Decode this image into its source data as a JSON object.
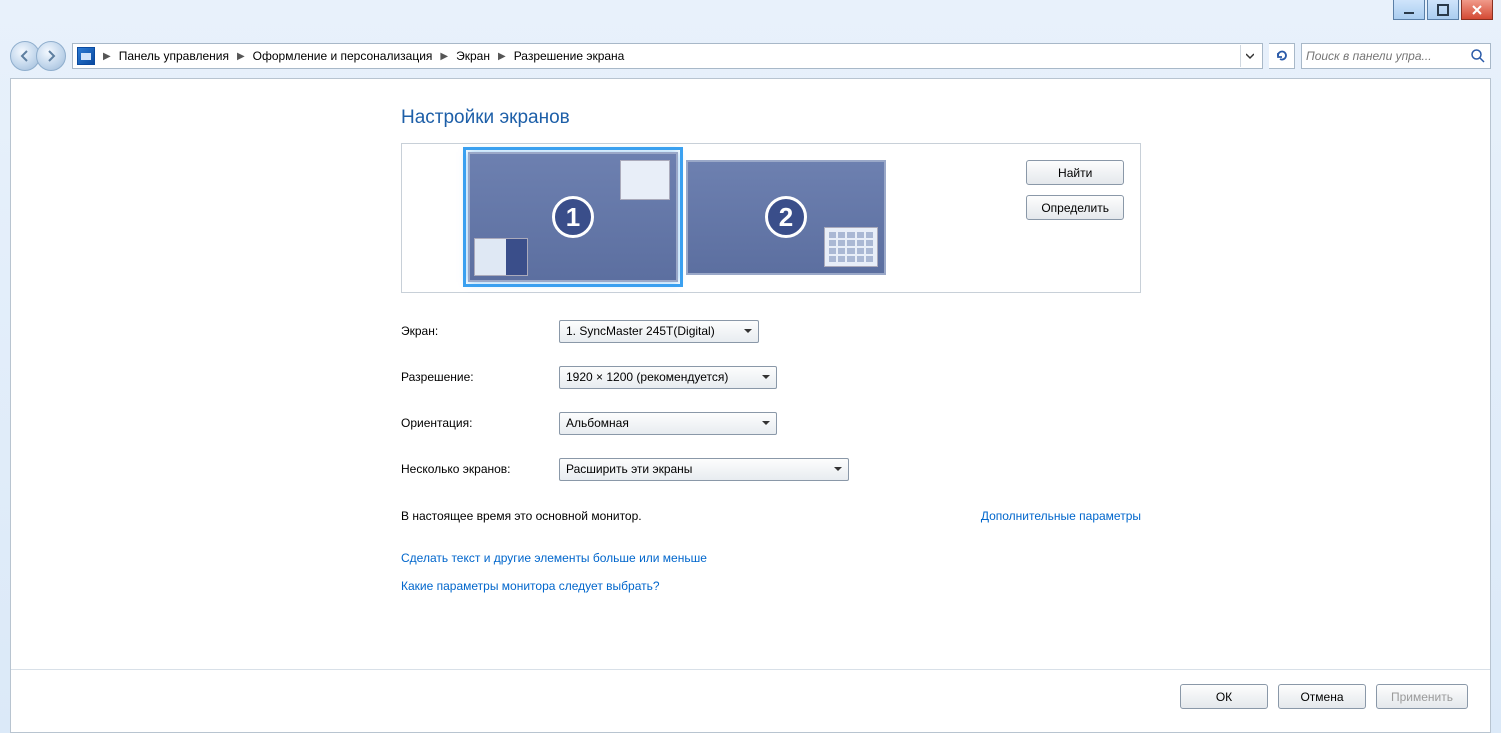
{
  "window_controls": {
    "min": "min",
    "max": "max",
    "close": "close"
  },
  "breadcrumbs": {
    "items": [
      "Панель управления",
      "Оформление и персонализация",
      "Экран",
      "Разрешение экрана"
    ]
  },
  "search": {
    "placeholder": "Поиск в панели упра..."
  },
  "title": "Настройки экранов",
  "preview": {
    "monitors": [
      {
        "num": "1",
        "selected": true
      },
      {
        "num": "2",
        "selected": false
      }
    ],
    "find_btn": "Найти",
    "identify_btn": "Определить"
  },
  "form": {
    "display_label": "Экран:",
    "display_value": "1. SyncMaster 245T(Digital)",
    "resolution_label": "Разрешение:",
    "resolution_value": "1920 × 1200 (рекомендуется)",
    "orientation_label": "Ориентация:",
    "orientation_value": "Альбомная",
    "multi_label": "Несколько экранов:",
    "multi_value": "Расширить эти экраны"
  },
  "info": {
    "primary_text": "В настоящее время это основной монитор.",
    "advanced_link": "Дополнительные параметры"
  },
  "links": {
    "text_size": "Сделать текст и другие элементы больше или меньше",
    "which_params": "Какие параметры монитора следует выбрать?"
  },
  "footer": {
    "ok": "ОК",
    "cancel": "Отмена",
    "apply": "Применить"
  }
}
